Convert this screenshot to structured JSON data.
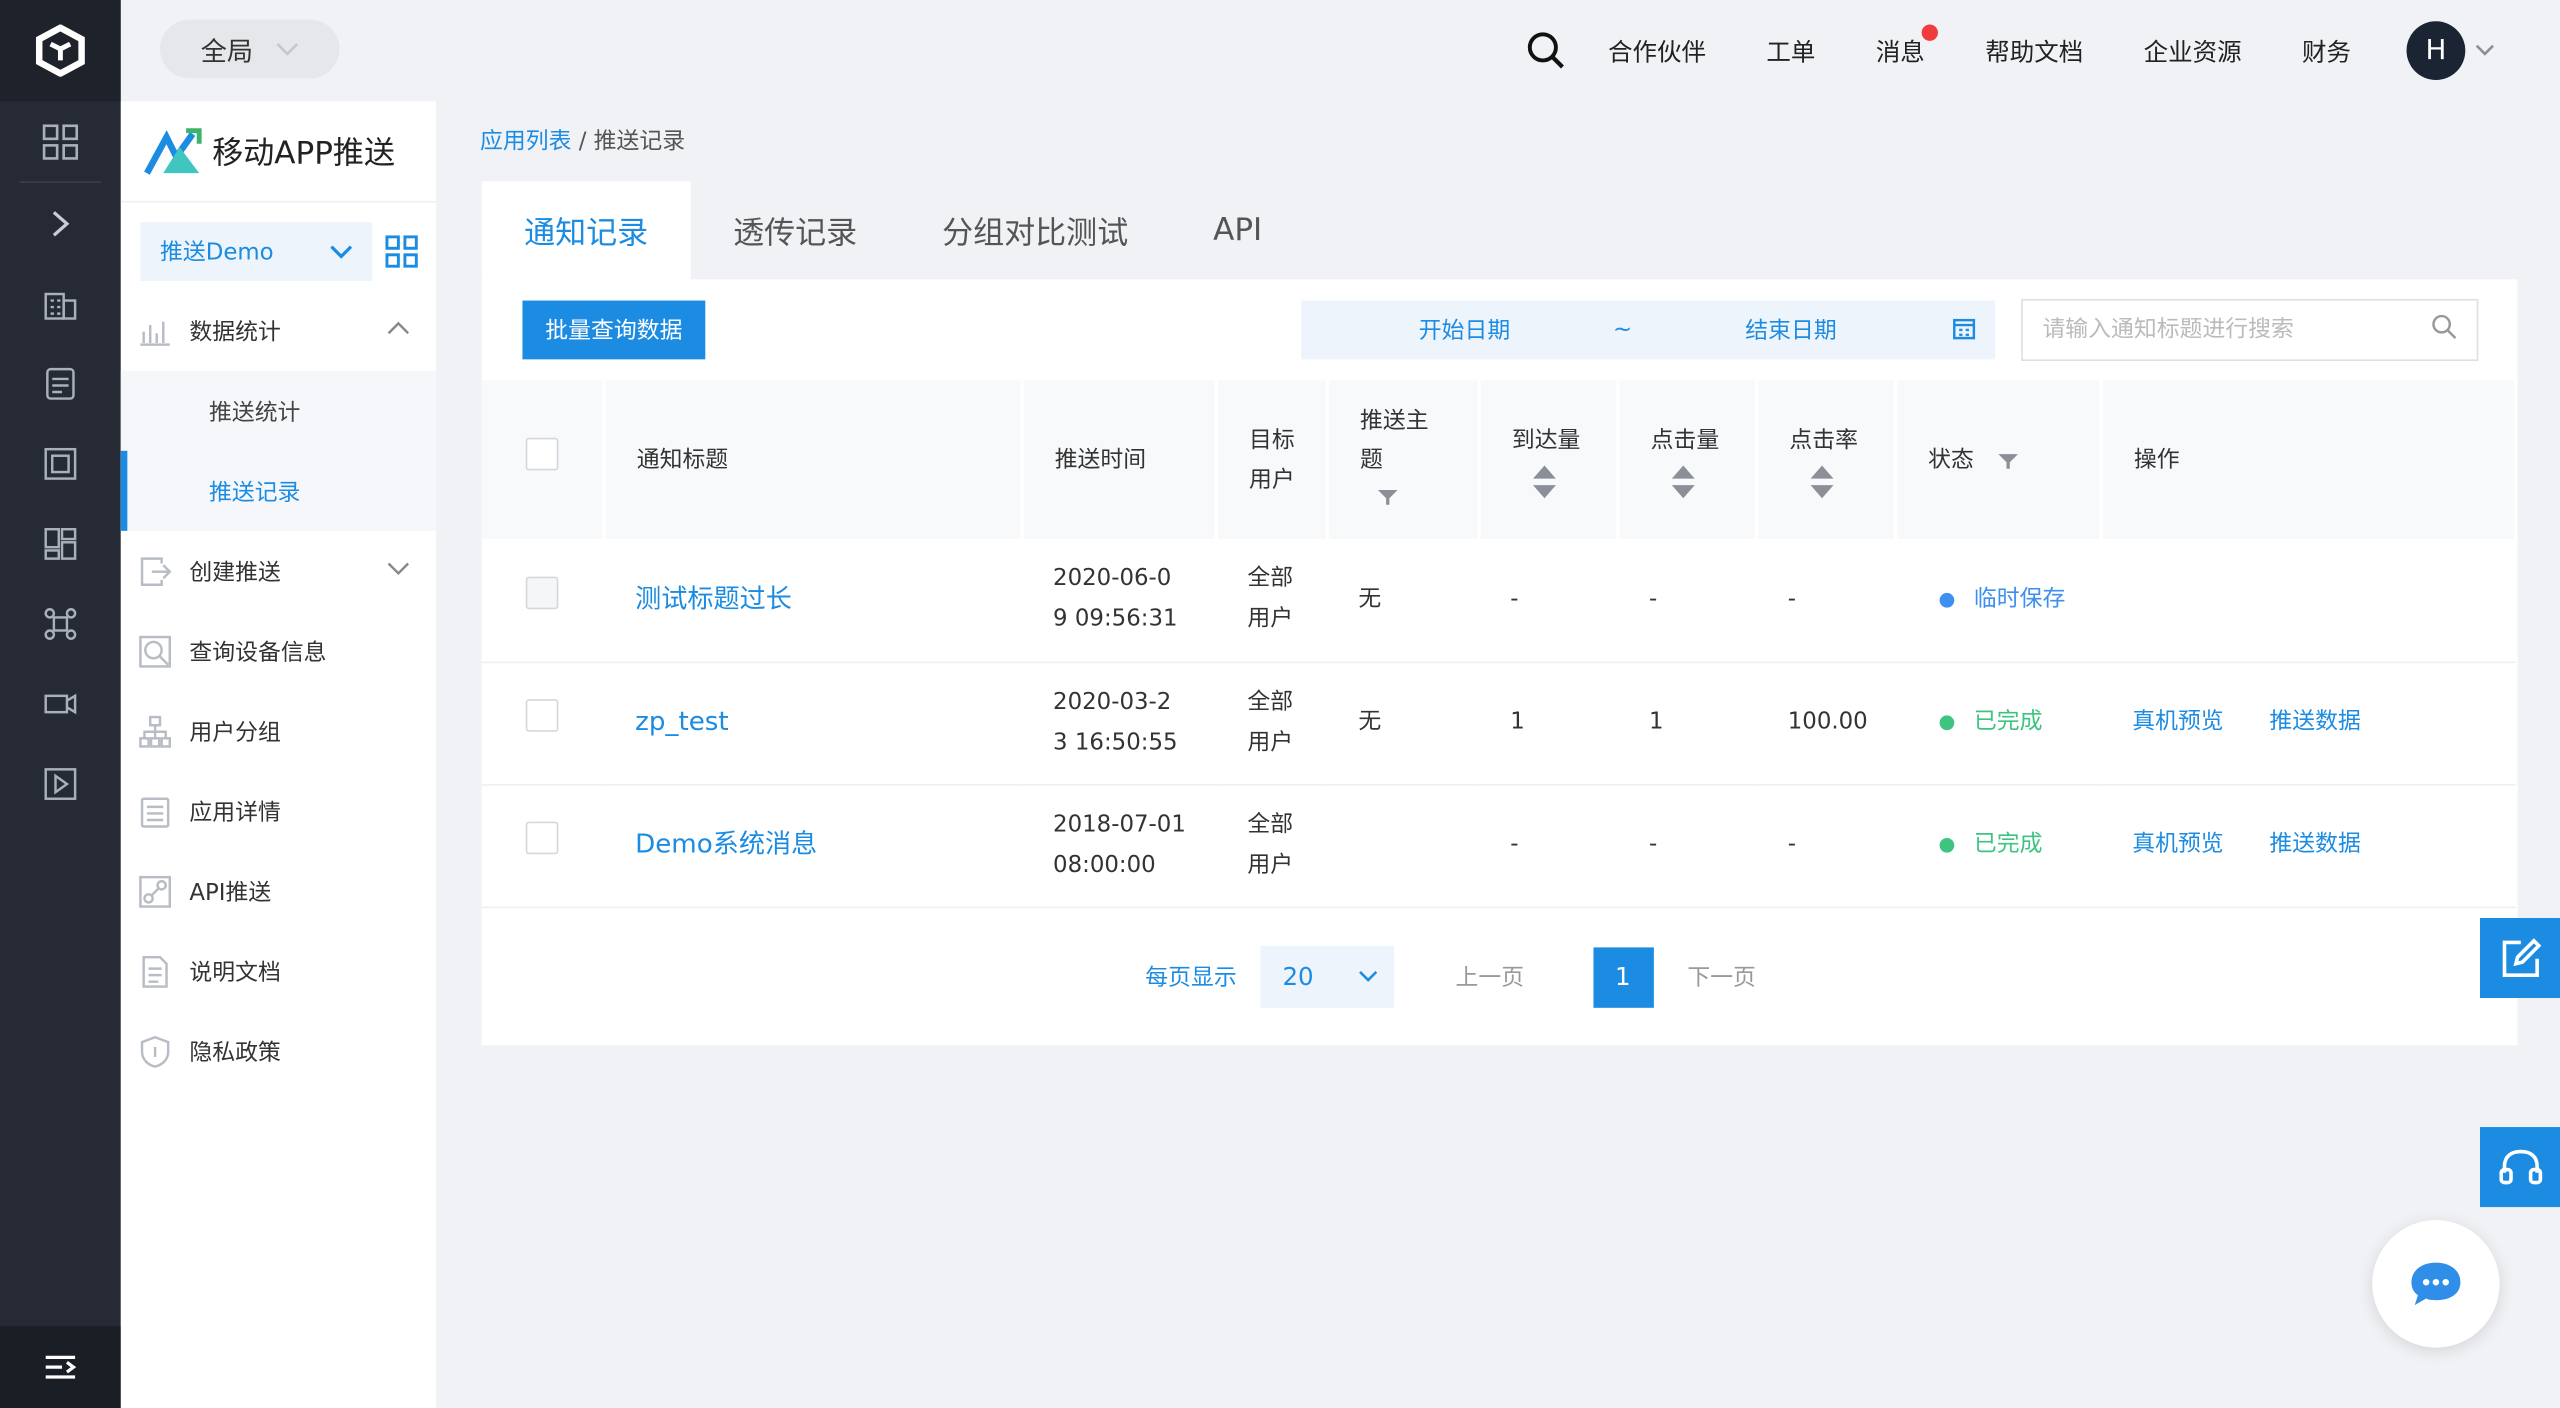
{
  "header": {
    "scope_label": "全局",
    "nav": [
      "合作伙伴",
      "工单",
      "消息",
      "帮助文档",
      "企业资源",
      "财务"
    ],
    "avatar_initial": "H"
  },
  "sidebar": {
    "brand": "移动APP推送",
    "app_selected": "推送Demo",
    "menu": {
      "stats": "数据统计",
      "stats_sub": [
        "推送统计",
        "推送记录"
      ],
      "create": "创建推送",
      "device": "查询设备信息",
      "group": "用户分组",
      "detail": "应用详情",
      "api": "API推送",
      "docs": "说明文档",
      "privacy": "隐私政策"
    }
  },
  "breadcrumb": {
    "parent": "应用列表",
    "separator": " / ",
    "current": "推送记录"
  },
  "tabs": [
    "通知记录",
    "透传记录",
    "分组对比测试",
    "API"
  ],
  "toolbar": {
    "batch_label": "批量查询数据",
    "date_start": "开始日期",
    "date_sep": "~",
    "date_end": "结束日期",
    "search_placeholder": "请输入通知标题进行搜索"
  },
  "table": {
    "headers": {
      "title": "通知标题",
      "time": "推送时间",
      "target": "目标用户",
      "topic": "推送主题",
      "arrive": "到达量",
      "click": "点击量",
      "rate": "点击率",
      "status": "状态",
      "ops": "操作"
    },
    "rows": [
      {
        "title": "测试标题过长",
        "time_a": "2020-06-0",
        "time_b": "9 09:56:31",
        "target_a": "全部",
        "target_b": "用户",
        "topic": "无",
        "arrive": "-",
        "click": "-",
        "rate": "-",
        "status": "临时保存",
        "op1": "",
        "op2": ""
      },
      {
        "title": "zp_test",
        "time_a": "2020-03-2",
        "time_b": "3 16:50:55",
        "target_a": "全部",
        "target_b": "用户",
        "topic": "无",
        "arrive": "1",
        "click": "1",
        "rate": "100.00",
        "status": "已完成",
        "op1": "真机预览",
        "op2": "推送数据"
      },
      {
        "title": "Demo系统消息",
        "time_a": "2018-07-01",
        "time_b": "08:00:00",
        "target_a": "全部",
        "target_b": "用户",
        "topic": "",
        "arrive": "-",
        "click": "-",
        "rate": "-",
        "status": "已完成",
        "op1": "真机预览",
        "op2": "推送数据"
      }
    ]
  },
  "pagination": {
    "per_page_label": "每页显示",
    "per_page": "20",
    "prev": "上一页",
    "current": "1",
    "next": "下一页"
  },
  "colors": {
    "accent": "#1c8ce3",
    "done": "#3cc480",
    "draft": "#3d8ff0",
    "rail": "#252a34",
    "danger": "#e8312f"
  }
}
